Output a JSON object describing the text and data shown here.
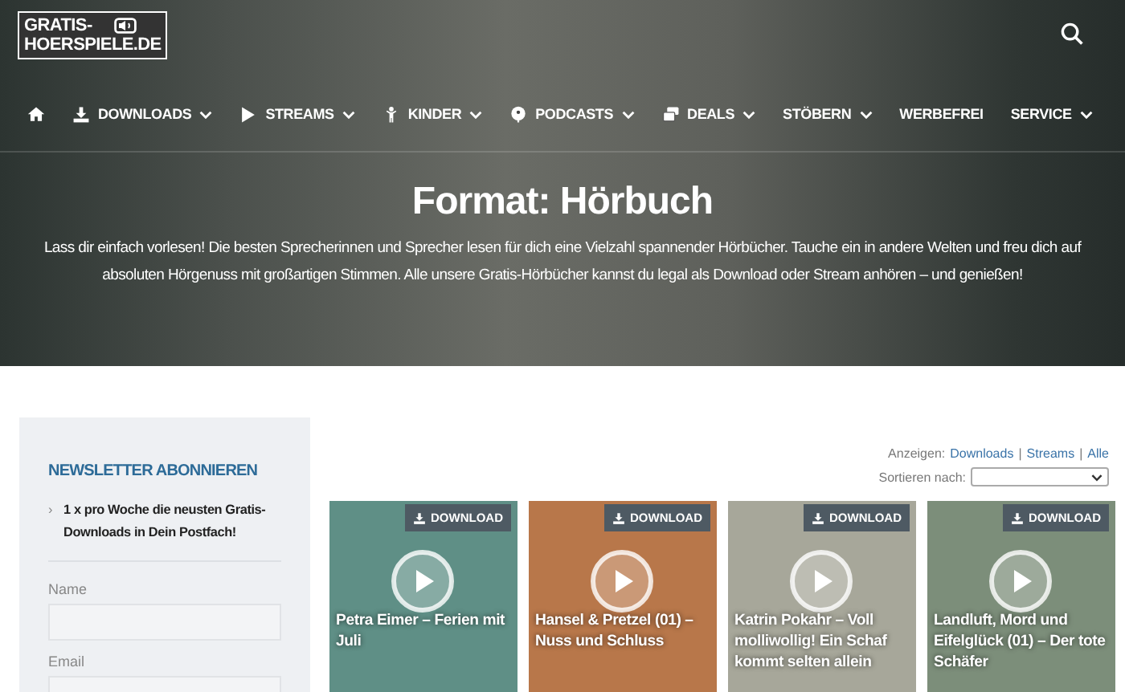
{
  "header": {
    "logo": {
      "line_1": "GRATIS-",
      "line_2": "HOERSPIELE.DE"
    },
    "nav": [
      {
        "kind": "home",
        "has_menu": false
      },
      {
        "kind": "download",
        "label": "DOWNLOADS",
        "has_menu": true
      },
      {
        "kind": "play",
        "label": "STREAMS",
        "has_menu": true
      },
      {
        "kind": "child",
        "label": "KINDER",
        "has_menu": true
      },
      {
        "kind": "podcast",
        "label": "PODCASTS",
        "has_menu": true
      },
      {
        "kind": "deals",
        "label": "DEALS",
        "has_menu": true
      },
      {
        "kind": "text",
        "label": "STÖBERN",
        "has_menu": true
      },
      {
        "kind": "text",
        "label": "WERBEFREI",
        "has_menu": false
      },
      {
        "kind": "text",
        "label": "SERVICE",
        "has_menu": true
      }
    ]
  },
  "hero": {
    "title": "Format: Hörbuch",
    "description": "Lass dir einfach vorlesen! Die besten Sprecherinnen und Sprecher lesen für dich eine Vielzahl spannender Hörbücher. Tauche ein in andere Welten und freu dich auf absoluten Hörgenuss mit großartigen Stimmen. Alle unsere Gratis-Hörbücher kannst du legal als Download oder Stream anhören – und genießen!"
  },
  "sidebar": {
    "title": "NEWSLETTER ABONNIEREN",
    "points": [
      {
        "marker": "›",
        "text": "1 x pro Woche die neusten Gratis-Downloads in Dein Postfach!"
      }
    ],
    "fields": [
      {
        "label": "Name"
      },
      {
        "label": "Email"
      }
    ]
  },
  "filter": {
    "label": "Anzeigen:",
    "links": [
      "Downloads",
      "Streams",
      "Alle"
    ],
    "separator": "|",
    "sort_label": "Sortieren nach:"
  },
  "cards": [
    {
      "badge": "DOWNLOAD",
      "title": "Petra Eimer – Ferien mit Juli",
      "color": "#5f8f86"
    },
    {
      "badge": "DOWNLOAD",
      "title": "Hansel & Pretzel (01) – Nuss und Schluss",
      "color": "#b8774a"
    },
    {
      "badge": "DOWNLOAD",
      "title": "Katrin Pokahr – Voll molliwollig! Ein Schaf kommt selten allein",
      "color": "#a7a79a"
    },
    {
      "badge": "DOWNLOAD",
      "title": "Landluft, Mord und Eifelglück (01) – Der tote Schäfer",
      "color": "#7c8e7a"
    }
  ]
}
